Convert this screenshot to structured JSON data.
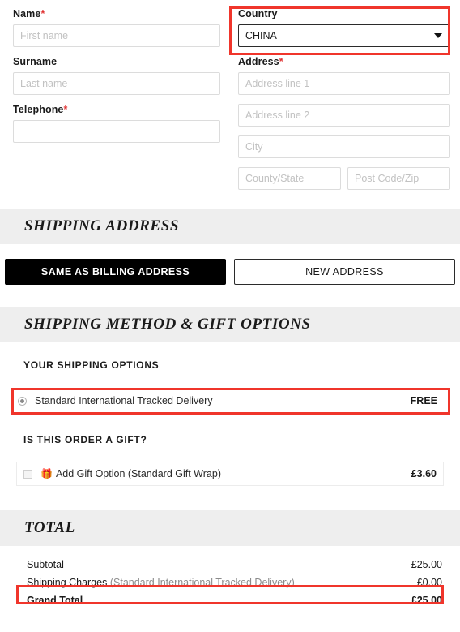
{
  "billing": {
    "fields": {
      "name_label": "Name",
      "name_placeholder": "First name",
      "name_value": "",
      "surname_label": "Surname",
      "surname_placeholder": "Last name",
      "surname_value": "",
      "telephone_label": "Telephone",
      "telephone_placeholder": "",
      "telephone_value": "",
      "country_label": "Country",
      "country_value": "CHINA",
      "address_label": "Address",
      "address1_placeholder": "Address line 1",
      "address1_value": "",
      "address2_placeholder": "Address line 2",
      "address2_value": "",
      "city_placeholder": "City",
      "city_value": "",
      "county_placeholder": "County/State",
      "county_value": "",
      "postcode_placeholder": "Post Code/Zip",
      "postcode_value": ""
    },
    "required_marker": "*"
  },
  "shipping_address": {
    "heading": "SHIPPING ADDRESS",
    "same_as_billing_button": "SAME AS BILLING ADDRESS",
    "new_address_button": "NEW ADDRESS"
  },
  "shipping_method": {
    "heading": "SHIPPING METHOD & GIFT OPTIONS",
    "options_subhead": "YOUR SHIPPING OPTIONS",
    "options": [
      {
        "label": "Standard International Tracked Delivery",
        "price": "FREE",
        "selected": true
      }
    ],
    "gift_subhead": "IS THIS ORDER A GIFT?",
    "gift_icon": "gift-icon",
    "gift_option": {
      "label": "Add Gift Option (Standard Gift Wrap)",
      "price": "£3.60",
      "checked": false
    }
  },
  "total": {
    "heading": "TOTAL",
    "rows": [
      {
        "label": "Subtotal",
        "sub": "",
        "value": "£25.00",
        "bold": false
      },
      {
        "label": "Shipping Charges",
        "sub": " (Standard International Tracked Delivery)",
        "value": "£0.00",
        "bold": false
      },
      {
        "label": "Grand Total",
        "sub": "",
        "value": "£25.00",
        "bold": true
      }
    ]
  },
  "annotations": {
    "color": "#f0352b",
    "boxes": [
      "country-select",
      "shipping-option-row",
      "shipping-charges-row"
    ]
  }
}
